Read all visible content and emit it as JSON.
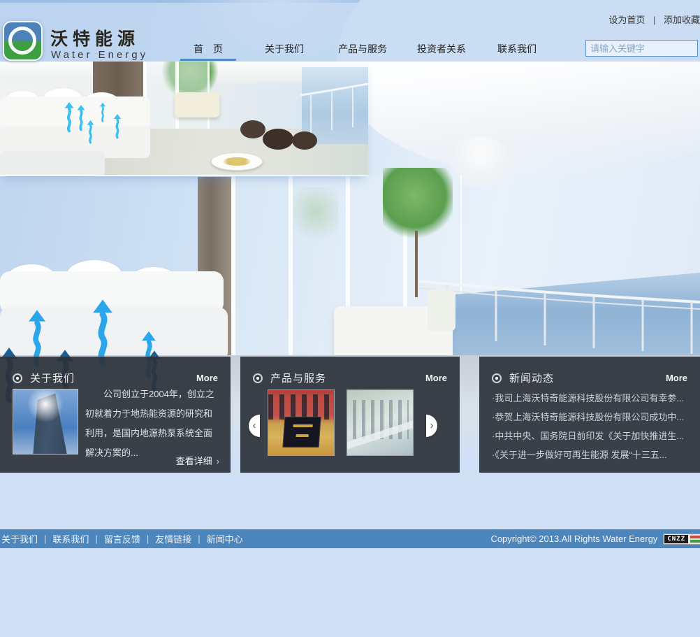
{
  "topbar": {
    "set_home": "设为首页",
    "sep": "|",
    "add_favorite": "添加收藏"
  },
  "brand": {
    "name": "沃特能源",
    "subtitle": "Water Energy"
  },
  "nav": {
    "items": [
      {
        "label": "首　页"
      },
      {
        "label": "关于我们"
      },
      {
        "label": "产品与服务"
      },
      {
        "label": "投资者关系"
      },
      {
        "label": "联系我们"
      }
    ]
  },
  "search": {
    "placeholder": "请输入关键字"
  },
  "panels": {
    "about": {
      "title": "关于我们",
      "more": "More",
      "text": "公司创立于2004年，创立之初就着力于地热能资源的研究和利用，是国内地源热泵系统全面解决方案的...",
      "detail": "查看详细",
      "detail_arrow": "›"
    },
    "products": {
      "title": "产品与服务",
      "more": "More",
      "prev": "‹",
      "next": "›"
    },
    "news": {
      "title": "新闻动态",
      "more": "More",
      "items": [
        "·我司上海沃特奇能源科技股份有限公司有幸参...",
        "·恭贺上海沃特奇能源科技股份有限公司成功中...",
        "·中共中央、国务院日前印发《关于加快推进生...",
        "·《关于进一步做好可再生能源 发展“十三五..."
      ]
    }
  },
  "footer": {
    "links": [
      "关于我们",
      "联系我们",
      "留言反馈",
      "友情链接",
      "新闻中心"
    ],
    "sep": "|",
    "copyright": "Copyright© 2013.All Rights Water Energy",
    "badge": "CNZZ"
  },
  "colors": {
    "accent": "#4e8cc8",
    "footer_bar": "#4d85bd",
    "panel_bg": "#2d323a",
    "arrow_blue": "#2ba6ea",
    "logo_blue": "#4d82b8",
    "logo_green": "#3f9e44"
  }
}
